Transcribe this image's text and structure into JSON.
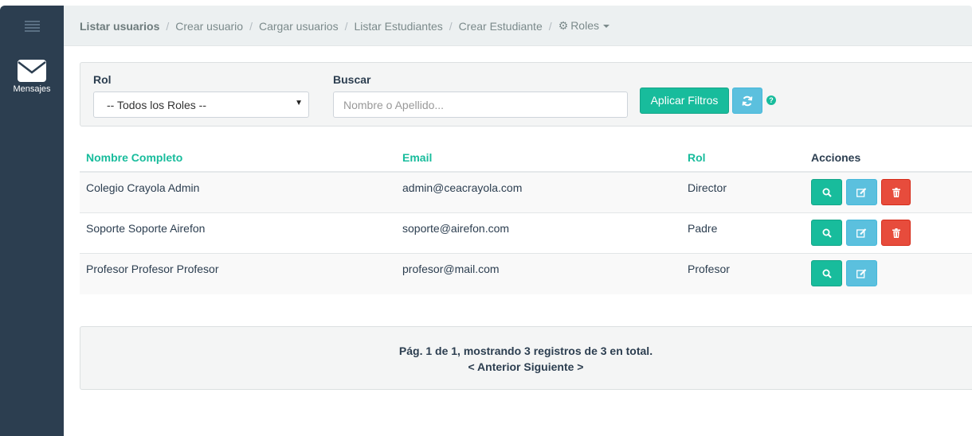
{
  "sidebar": {
    "messages_label": "Mensajes"
  },
  "breadcrumb": {
    "items": [
      "Listar usuarios",
      "Crear usuario",
      "Cargar usuarios",
      "Listar Estudiantes",
      "Crear Estudiante"
    ],
    "roles_label": "Roles"
  },
  "filters": {
    "rol_label": "Rol",
    "rol_selected": "-- Todos los Roles --",
    "search_label": "Buscar",
    "search_placeholder": "Nombre o Apellido...",
    "apply_label": "Aplicar Filtros"
  },
  "table": {
    "headers": [
      "Nombre Completo",
      "Email",
      "Rol",
      "Acciones"
    ],
    "rows": [
      {
        "name": "Colegio Crayola Admin",
        "email": "admin@ceacrayola.com",
        "role": "Director"
      },
      {
        "name": "Soporte Soporte Airefon",
        "email": "soporte@airefon.com",
        "role": "Padre"
      },
      {
        "name": "Profesor Profesor Profesor",
        "email": "profesor@mail.com",
        "role": "Profesor"
      }
    ]
  },
  "pagination": {
    "info": "Pág. 1 de 1, mostrando 3 registros de 3 en total.",
    "prev": "< Anterior",
    "next": "Siguiente >"
  },
  "colors": {
    "sidebar": "#2c3e50",
    "primary": "#18bc9c",
    "info": "#5bc0de",
    "danger": "#e74c3c"
  }
}
